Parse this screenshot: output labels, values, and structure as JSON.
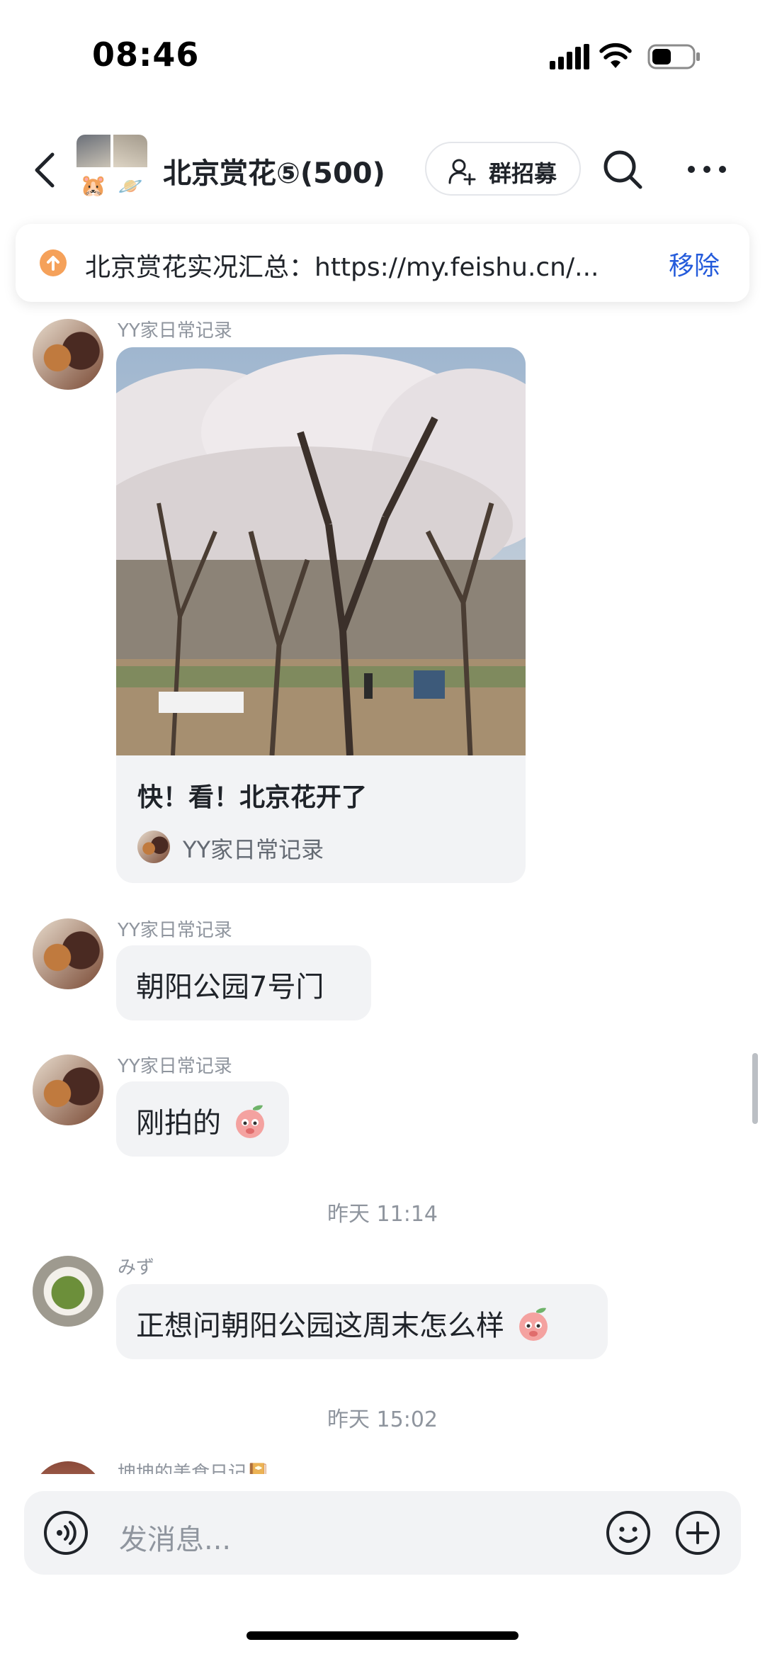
{
  "status_bar": {
    "time": "08:46"
  },
  "header": {
    "title": "北京赏花⑤(500)",
    "recruit_label": "群招募"
  },
  "pinned": {
    "text": "北京赏花实况汇总：https://my.feishu.cn/...",
    "remove_label": "移除"
  },
  "messages": [
    {
      "sender": "YY家日常记录",
      "card": {
        "title": "快！看！北京花开了",
        "source": "YY家日常记录"
      }
    },
    {
      "sender": "YY家日常记录",
      "text": "朝阳公园7号门"
    },
    {
      "sender": "YY家日常记录",
      "text": "刚拍的"
    },
    {
      "timestamp": "昨天 11:14"
    },
    {
      "sender": "みず",
      "text": "正想问朝阳公园这周末怎么样"
    },
    {
      "timestamp": "昨天 15:02"
    },
    {
      "sender": "坤坤的美食日记📔"
    }
  ],
  "input": {
    "placeholder": "发消息..."
  },
  "icons": [
    "back-icon",
    "group-avatar",
    "add-user-icon",
    "search-icon",
    "more-icon",
    "pin-icon",
    "voice-icon",
    "emoji-icon",
    "plus-icon"
  ],
  "colors": {
    "accent": "#245bdb",
    "bubble": "#f2f3f5",
    "pin": "#f5a15a"
  }
}
